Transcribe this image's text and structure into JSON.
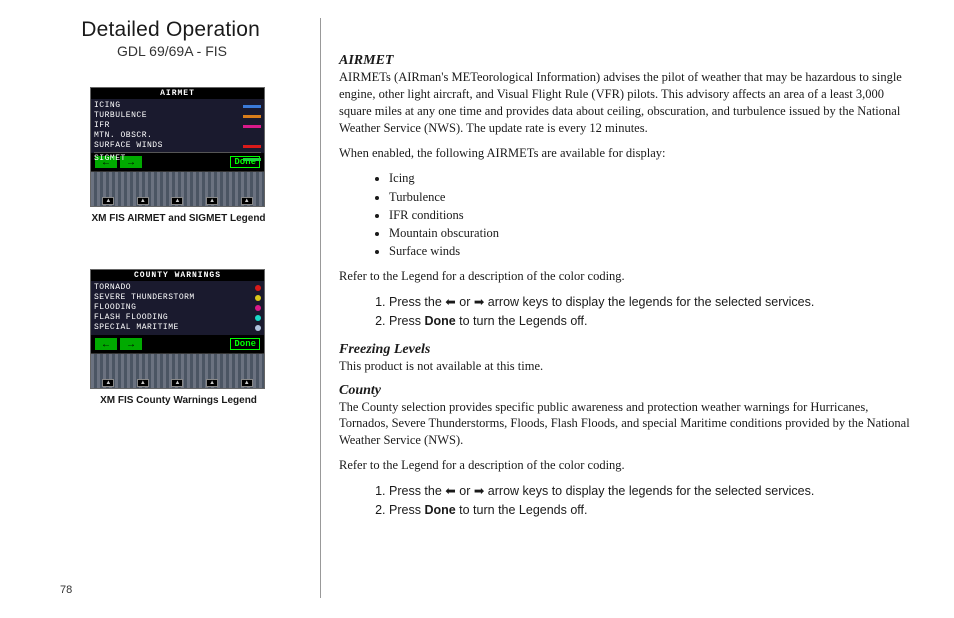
{
  "header": {
    "title": "Detailed Operation",
    "subtitle": "GDL 69/69A - FIS"
  },
  "page_number": "78",
  "figures": [
    {
      "panel_title": "AIRMET",
      "rows": [
        {
          "label": "ICING",
          "color": "#3a7ad9"
        },
        {
          "label": "TURBULENCE",
          "color": "#d97d1a"
        },
        {
          "label": "IFR",
          "color": "#d91a8a"
        },
        {
          "label": "MTN. OBSCR.",
          "color": ""
        },
        {
          "label": "SURFACE WINDS",
          "color": "#d91a1a"
        }
      ],
      "bottom_row": {
        "label": "SIGMET",
        "color": "#1ad93a"
      },
      "done": "Done",
      "caption": "XM FIS AIRMET and SIGMET Legend"
    },
    {
      "panel_title": "COUNTY WARNINGS",
      "rows": [
        {
          "label": "TORNADO",
          "color": "#d91a1a"
        },
        {
          "label": "SEVERE THUNDERSTORM",
          "color": "#d9c81a"
        },
        {
          "label": "FLOODING",
          "color": "#d91a8a"
        },
        {
          "label": "FLASH FLOODING",
          "color": "#1ad9c8"
        },
        {
          "label": "SPECIAL MARITIME",
          "color": "#b0c4de"
        }
      ],
      "done": "Done",
      "caption": "XM FIS County Warnings Legend"
    }
  ],
  "sections": {
    "airmet": {
      "heading": "AIRMET",
      "p1": "AIRMETs (AIRman's METeorological Information) advises the pilot of weather that may be hazardous to single engine, other light aircraft, and Visual Flight Rule (VFR) pilots. This advisory affects an area of a least 3,000 square miles at any one time and provides data about ceiling, obscuration, and turbulence issued by the National Weather Service (NWS). The update rate is every 12 minutes.",
      "p2": "When enabled, the following AIRMETs are available for display:",
      "bullets": [
        "Icing",
        "Turbulence",
        "IFR conditions",
        "Mountain obscuration",
        "Surface winds"
      ],
      "p3": "Refer to the Legend for a description of the color coding.",
      "step1_pre": "Press the ",
      "step1_mid": " or ",
      "step1_post": " arrow keys to display the legends for the selected services.",
      "step2_pre": "Press ",
      "step2_bold": "Done",
      "step2_post": " to turn the Legends off."
    },
    "freezing": {
      "heading": "Freezing Levels",
      "p1": "This product is not available at this time."
    },
    "county": {
      "heading": "County",
      "p1": "The County selection provides specific public awareness and protection weather warnings for Hurricanes, Tornados, Severe Thunderstorms, Floods, Flash Floods, and special Maritime conditions provided by the National Weather Service (NWS).",
      "p2": "Refer to the Legend for a description of the color coding.",
      "step1_pre": "Press the ",
      "step1_mid": " or ",
      "step1_post": " arrow keys to display the legends for the selected services.",
      "step2_pre": "Press ",
      "step2_bold": "Done",
      "step2_post": " to turn the Legends off."
    }
  }
}
